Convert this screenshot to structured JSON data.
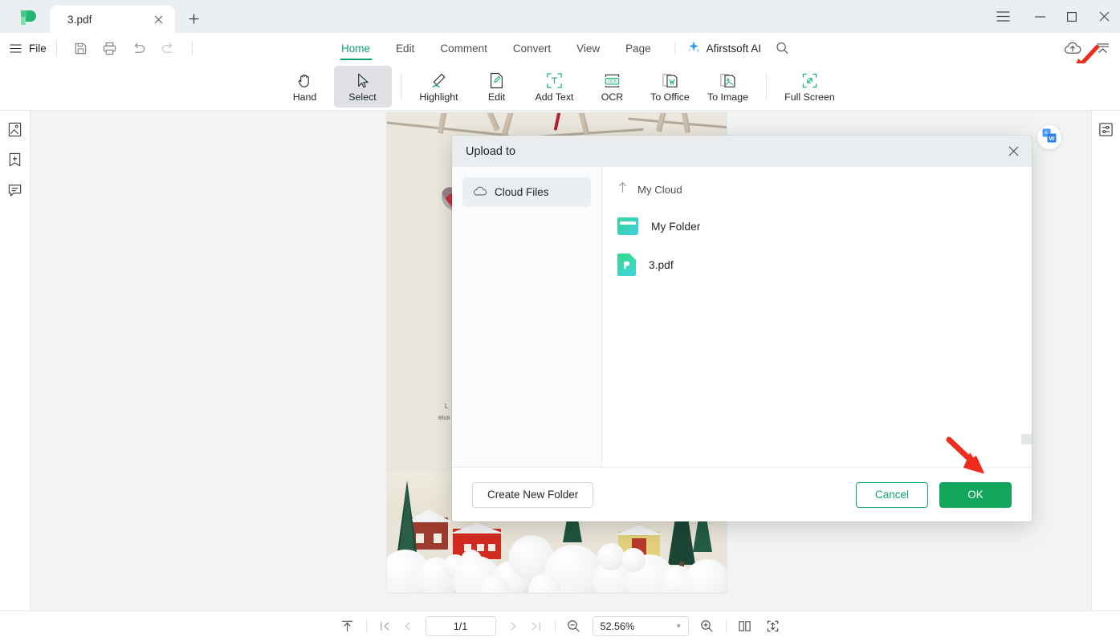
{
  "window": {
    "app_logo": "afirstsoft-logo",
    "tabs": [
      {
        "label": "3.pdf",
        "close": "×"
      }
    ],
    "new_tab": "+",
    "controls": {
      "menu": "hamburger-icon",
      "minimize": "—",
      "maximize": "□",
      "close": "✕"
    }
  },
  "menubar": {
    "file_label": "File",
    "quick_icons": [
      "save-icon",
      "print-icon",
      "undo-icon",
      "redo-icon"
    ],
    "ribbon_tabs": [
      {
        "label": "Home",
        "active": true
      },
      {
        "label": "Edit",
        "active": false
      },
      {
        "label": "Comment",
        "active": false
      },
      {
        "label": "Convert",
        "active": false
      },
      {
        "label": "View",
        "active": false
      },
      {
        "label": "Page",
        "active": false
      }
    ],
    "ai_label": "Afirstsoft AI",
    "search_icon": "search-icon",
    "cloud_upload_icon": "cloud-upload-icon",
    "collapse_icon": "collapse-ribbon-icon"
  },
  "toolbar": {
    "items": [
      {
        "label": "Hand",
        "icon": "hand-icon",
        "selected": false
      },
      {
        "label": "Select",
        "icon": "cursor-arrow-icon",
        "selected": true
      },
      {
        "label": "Highlight",
        "icon": "highlighter-icon",
        "selected": false
      },
      {
        "label": "Edit",
        "icon": "edit-document-icon",
        "selected": false
      },
      {
        "label": "Add Text",
        "icon": "add-text-icon",
        "selected": false
      },
      {
        "label": "OCR",
        "icon": "ocr-icon",
        "selected": false
      },
      {
        "label": "To Office",
        "icon": "to-office-icon",
        "selected": false
      },
      {
        "label": "To Image",
        "icon": "to-image-icon",
        "selected": false
      },
      {
        "label": "Full Screen",
        "icon": "full-screen-icon",
        "selected": false
      }
    ]
  },
  "left_rail": {
    "items": [
      {
        "icon": "thumbnail-icon"
      },
      {
        "icon": "bookmark-add-icon"
      },
      {
        "icon": "comment-list-icon"
      }
    ]
  },
  "right_rail": {
    "items": [
      {
        "icon": "properties-panel-icon"
      }
    ]
  },
  "viewer": {
    "float_button_icon": "translate-to-word-icon",
    "page_text_line1": "L",
    "page_text_line2": "eius"
  },
  "dialog": {
    "title": "Upload to",
    "close_icon": "close-icon",
    "sidebar": [
      {
        "label": "Cloud Files",
        "icon": "cloud-icon"
      }
    ],
    "breadcrumb": {
      "up_icon": "arrow-up-icon",
      "label": "My Cloud"
    },
    "files": [
      {
        "name": "My Folder",
        "type": "folder"
      },
      {
        "name": "3.pdf",
        "type": "pdf"
      }
    ],
    "buttons": {
      "create_folder": "Create New Folder",
      "cancel": "Cancel",
      "ok": "OK"
    }
  },
  "statusbar": {
    "fit_top_icon": "scroll-to-top-icon",
    "first_page_icon": "first-page-icon",
    "prev_page_icon": "prev-page-icon",
    "page_value": "1/1",
    "next_page_icon": "next-page-icon",
    "last_page_icon": "last-page-icon",
    "zoom_out_icon": "zoom-out-icon",
    "zoom_value": "52.56%",
    "zoom_caret": "▾",
    "zoom_in_icon": "zoom-in-icon",
    "dual_page_icon": "dual-page-icon",
    "fit_height_icon": "fit-height-icon"
  },
  "colors": {
    "accent_green": "#11a36a",
    "ok_button_green": "#12a65c",
    "titlebar_bg": "#eceff1",
    "viewer_bg": "#f1f3f4",
    "dialog_header_bg": "#e9edf0",
    "annotation_red": "#ee2b1c"
  }
}
